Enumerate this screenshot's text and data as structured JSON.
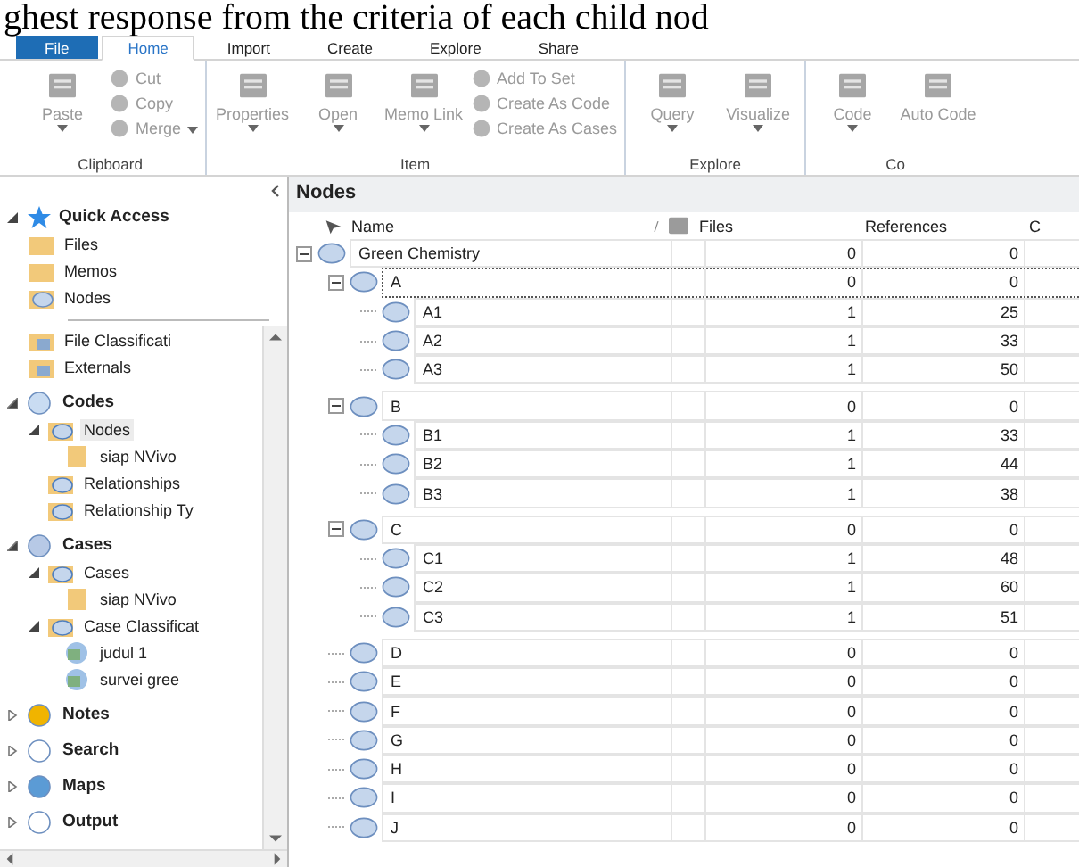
{
  "caption": "ghest response from the criteria of each child nod",
  "ribbon": {
    "tabs": [
      {
        "label": "File",
        "kind": "file",
        "selected": false
      },
      {
        "label": "Home",
        "kind": "tab",
        "selected": true
      },
      {
        "label": "Import",
        "kind": "tab",
        "selected": false
      },
      {
        "label": "Create",
        "kind": "tab",
        "selected": false
      },
      {
        "label": "Explore",
        "kind": "tab",
        "selected": false
      },
      {
        "label": "Share",
        "kind": "tab",
        "selected": false
      }
    ],
    "groups": [
      {
        "label": "Clipboard",
        "buttons": [
          {
            "label": "Paste",
            "kind": "large",
            "dropdown": true,
            "disabled": true
          },
          {
            "label": "Cut",
            "kind": "small",
            "dropdown": false,
            "disabled": true
          },
          {
            "label": "Copy",
            "kind": "small",
            "dropdown": false,
            "disabled": true
          },
          {
            "label": "Merge",
            "kind": "small",
            "dropdown": true,
            "disabled": true
          }
        ]
      },
      {
        "label": "Item",
        "buttons": [
          {
            "label": "Properties",
            "kind": "large",
            "dropdown": true,
            "disabled": true
          },
          {
            "label": "Open",
            "kind": "large",
            "dropdown": true,
            "disabled": true
          },
          {
            "label": "Memo Link",
            "kind": "large",
            "dropdown": true,
            "disabled": true
          },
          {
            "label": "Add To Set",
            "kind": "small",
            "dropdown": false,
            "disabled": true
          },
          {
            "label": "Create As Code",
            "kind": "small",
            "dropdown": false,
            "disabled": true
          },
          {
            "label": "Create As Cases",
            "kind": "small",
            "dropdown": false,
            "disabled": true
          }
        ]
      },
      {
        "label": "Explore",
        "buttons": [
          {
            "label": "Query",
            "kind": "large",
            "dropdown": true,
            "disabled": true
          },
          {
            "label": "Visualize",
            "kind": "large",
            "dropdown": true,
            "disabled": true
          }
        ]
      },
      {
        "label": "Co",
        "buttons": [
          {
            "label": "Code",
            "kind": "large",
            "dropdown": true,
            "disabled": true
          },
          {
            "label": "Auto Code",
            "kind": "large",
            "dropdown": false,
            "disabled": true
          }
        ]
      }
    ]
  },
  "navigation": {
    "quick_access": {
      "label": "Quick Access",
      "expanded": true,
      "items": [
        {
          "label": "Files",
          "selected": false
        },
        {
          "label": "Memos",
          "selected": false
        },
        {
          "label": "Nodes",
          "selected": false
        }
      ]
    },
    "tree": [
      {
        "label": "File Classificati",
        "kind": "item",
        "selected": false
      },
      {
        "label": "Externals",
        "kind": "item",
        "selected": false
      },
      {
        "label": "Codes",
        "kind": "section",
        "expanded": true,
        "selected": false,
        "children": [
          {
            "label": "Nodes",
            "selected": true,
            "expanded": true,
            "children": [
              {
                "label": "siap NVivo",
                "selected": false
              }
            ]
          },
          {
            "label": "Relationships",
            "selected": false
          },
          {
            "label": "Relationship Ty",
            "selected": false
          }
        ]
      },
      {
        "label": "Cases",
        "kind": "section",
        "expanded": true,
        "selected": false,
        "children": [
          {
            "label": "Cases",
            "selected": false,
            "expanded": true,
            "children": [
              {
                "label": "siap NVivo",
                "selected": false
              }
            ]
          },
          {
            "label": "Case Classificat",
            "selected": false,
            "expanded": true,
            "children": [
              {
                "label": "judul 1",
                "selected": false
              },
              {
                "label": "survei gree",
                "selected": false
              }
            ]
          }
        ]
      },
      {
        "label": "Notes",
        "kind": "section",
        "expanded": false,
        "selected": false
      },
      {
        "label": "Search",
        "kind": "section",
        "expanded": false,
        "selected": false
      },
      {
        "label": "Maps",
        "kind": "section",
        "expanded": false,
        "selected": false
      },
      {
        "label": "Output",
        "kind": "section",
        "expanded": false,
        "selected": false
      }
    ]
  },
  "nodes": {
    "title": "Nodes",
    "columns": [
      "Name",
      "Files",
      "References",
      "C"
    ],
    "rows": [
      {
        "name": "Green Chemistry",
        "files": "0",
        "references": "0",
        "expanded": true,
        "focused": false,
        "children": [
          {
            "name": "A",
            "files": "0",
            "references": "0",
            "expanded": true,
            "focused": true,
            "children": [
              {
                "name": "A1",
                "files": "1",
                "references": "25",
                "focused": false
              },
              {
                "name": "A2",
                "files": "1",
                "references": "33",
                "focused": false
              },
              {
                "name": "A3",
                "files": "1",
                "references": "50",
                "focused": false
              }
            ]
          },
          {
            "name": "B",
            "files": "0",
            "references": "0",
            "expanded": true,
            "focused": false,
            "children": [
              {
                "name": "B1",
                "files": "1",
                "references": "33",
                "focused": false
              },
              {
                "name": "B2",
                "files": "1",
                "references": "44",
                "focused": false
              },
              {
                "name": "B3",
                "files": "1",
                "references": "38",
                "focused": false
              }
            ]
          },
          {
            "name": "C",
            "files": "0",
            "references": "0",
            "expanded": true,
            "focused": false,
            "children": [
              {
                "name": "C1",
                "files": "1",
                "references": "48",
                "focused": false
              },
              {
                "name": "C2",
                "files": "1",
                "references": "60",
                "focused": false
              },
              {
                "name": "C3",
                "files": "1",
                "references": "51",
                "focused": false
              }
            ]
          },
          {
            "name": "D",
            "files": "0",
            "references": "0",
            "expanded": false,
            "focused": false
          },
          {
            "name": "E",
            "files": "0",
            "references": "0",
            "expanded": false,
            "focused": false
          },
          {
            "name": "F",
            "files": "0",
            "references": "0",
            "expanded": false,
            "focused": false
          },
          {
            "name": "G",
            "files": "0",
            "references": "0",
            "expanded": false,
            "focused": false
          },
          {
            "name": "H",
            "files": "0",
            "references": "0",
            "expanded": false,
            "focused": false
          },
          {
            "name": "I",
            "files": "0",
            "references": "0",
            "expanded": false,
            "focused": false
          },
          {
            "name": "J",
            "files": "0",
            "references": "0",
            "expanded": false,
            "focused": false
          }
        ]
      }
    ]
  }
}
